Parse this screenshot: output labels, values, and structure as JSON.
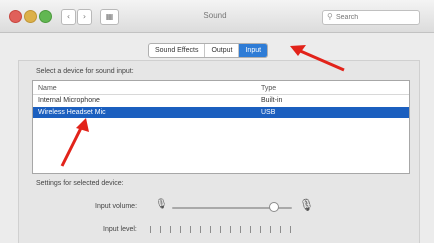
{
  "window": {
    "title": "Sound",
    "search_placeholder": "Search",
    "back_icon": "chevron-left-icon",
    "forward_icon": "chevron-right-icon",
    "grid_icon": "grid-icon"
  },
  "tabs": [
    {
      "label": "Sound Effects",
      "active": false
    },
    {
      "label": "Output",
      "active": false
    },
    {
      "label": "Input",
      "active": true
    }
  ],
  "device_section": {
    "label": "Select a device for sound input:",
    "columns": [
      "Name",
      "Type"
    ],
    "rows": [
      {
        "name": "Internal Microphone",
        "type": "Built-in",
        "selected": false
      },
      {
        "name": "Wireless Headset Mic",
        "type": "USB",
        "selected": true
      }
    ]
  },
  "settings_section": {
    "label": "Settings for selected device:",
    "input_volume_label": "Input volume:",
    "input_volume_level": 0.84,
    "input_level_label": "Input level:",
    "input_level_ticks": 15
  },
  "colors": {
    "accent": "#2e7cd6",
    "selection": "#1b5fbf",
    "annotation": "#e2231a"
  }
}
